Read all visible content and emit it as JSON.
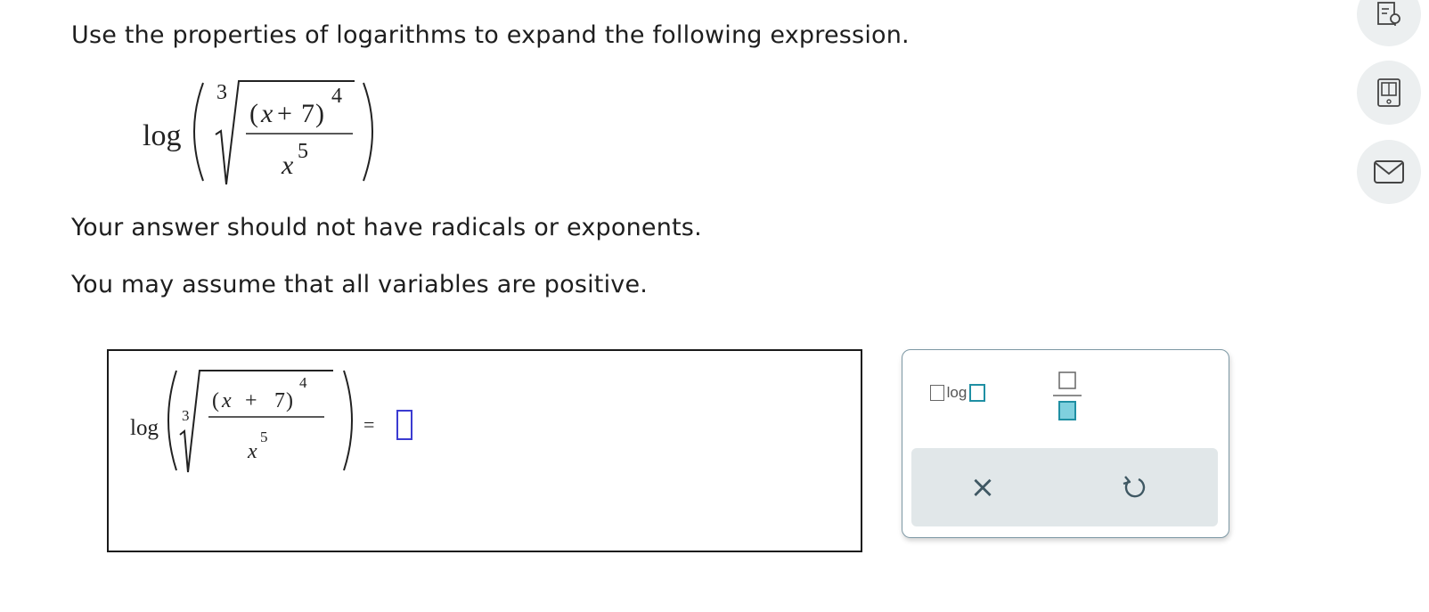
{
  "prompt": {
    "instruction": "Use the properties of logarithms to expand the following expression.",
    "note_radicals": "Your answer should not have radicals or exponents.",
    "note_positive": "You may assume that all variables are positive."
  },
  "expression": {
    "func": "log",
    "root_index": "3",
    "numerator_var": "x",
    "numerator_plus": "+",
    "numerator_const": "7",
    "numerator_exp": "4",
    "denominator_var": "x",
    "denominator_exp": "5"
  },
  "answer": {
    "func": "log",
    "root_index": "3",
    "numerator_var": "x",
    "numerator_plus": "+",
    "numerator_const": "7",
    "numerator_exp": "4",
    "denominator_var": "x",
    "denominator_exp": "5",
    "equals": "=",
    "input_value": ""
  },
  "keypad": {
    "log_base_label": "log",
    "clear_label": "×",
    "undo_icon": "undo-icon",
    "fraction_icon": "fraction-icon"
  },
  "sidebar": {
    "icons": [
      "hint-icon",
      "textbook-icon",
      "message-icon"
    ]
  },
  "colors": {
    "teal": "#1f8fa3",
    "input_border": "#3b3bd1",
    "keypad_border": "#7d98a4",
    "keypad_bottom": "#e1e7e9"
  }
}
